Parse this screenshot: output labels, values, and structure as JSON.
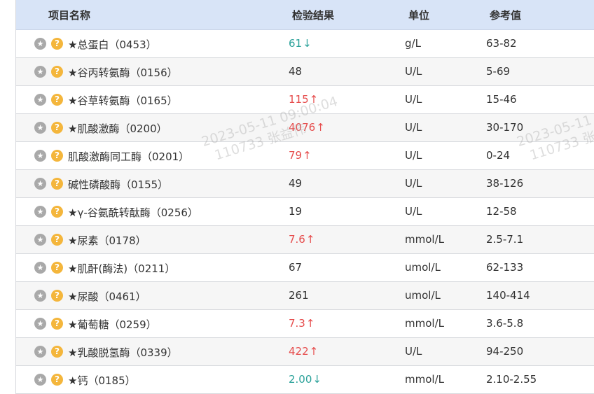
{
  "header": {
    "name": "项目名称",
    "result": "检验结果",
    "unit": "单位",
    "ref": "参考值"
  },
  "rows": [
    {
      "name": "★总蛋白（0453）",
      "result": "61",
      "flag": "low",
      "unit": "g/L",
      "ref": "63-82"
    },
    {
      "name": "★谷丙转氨酶（0156）",
      "result": "48",
      "flag": "normal",
      "unit": "U/L",
      "ref": "5-69"
    },
    {
      "name": "★谷草转氨酶（0165）",
      "result": "115",
      "flag": "high",
      "unit": "U/L",
      "ref": "15-46"
    },
    {
      "name": "★肌酸激酶（0200）",
      "result": "4076",
      "flag": "high",
      "unit": "U/L",
      "ref": "30-170"
    },
    {
      "name": "肌酸激酶同工酶（0201）",
      "result": "79",
      "flag": "high",
      "unit": "U/L",
      "ref": "0-24"
    },
    {
      "name": "碱性磷酸酶（0155）",
      "result": "49",
      "flag": "normal",
      "unit": "U/L",
      "ref": "38-126"
    },
    {
      "name": "★γ-谷氨酰转酞酶（0256）",
      "result": "19",
      "flag": "normal",
      "unit": "U/L",
      "ref": "12-58"
    },
    {
      "name": "★尿素（0178）",
      "result": "7.6",
      "flag": "high",
      "unit": "mmol/L",
      "ref": "2.5-7.1"
    },
    {
      "name": "★肌酐(酶法)（0211）",
      "result": "67",
      "flag": "normal",
      "unit": "umol/L",
      "ref": "62-133"
    },
    {
      "name": "★尿酸（0461）",
      "result": "261",
      "flag": "normal",
      "unit": "umol/L",
      "ref": "140-414"
    },
    {
      "name": "★葡萄糖（0259）",
      "result": "7.3",
      "flag": "high",
      "unit": "mmol/L",
      "ref": "3.6-5.8"
    },
    {
      "name": "★乳酸脱氢酶（0339）",
      "result": "422",
      "flag": "high",
      "unit": "U/L",
      "ref": "94-250"
    },
    {
      "name": "★钙（0185）",
      "result": "2.00",
      "flag": "low",
      "unit": "mmol/L",
      "ref": "2.10-2.55"
    }
  ],
  "arrows": {
    "high": "↑",
    "low": "↓",
    "normal": ""
  },
  "icons": {
    "favorite": "star-icon",
    "help": "question-icon",
    "help_glyph": "?"
  },
  "watermark": {
    "line1": "2023-05-11 09:00:04",
    "line2": "110733 张益伟"
  },
  "colors": {
    "header_bg": "#d8e4f7",
    "high": "#e64d4d",
    "low": "#2aa199",
    "help_icon": "#f4b63c",
    "star_icon": "#a9a9a9"
  }
}
